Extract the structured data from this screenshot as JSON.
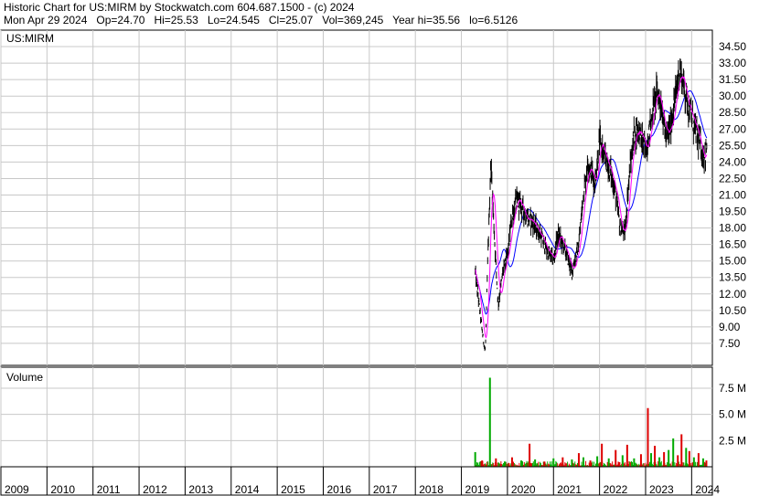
{
  "header": {
    "line1": "Historic Chart for US:MIRM by Stockwatch.com 604.687.1500 - (c) 2024",
    "line2": "Mon Apr 29 2024   Op=24.70   Hi=25.53   Lo=24.545   Cl=25.07   Vol=369,245   Year hi=35.56   lo=6.5126"
  },
  "chart_data": {
    "type": "line",
    "symbol_label": "US:MIRM",
    "volume_label": "Volume",
    "price_ylim": [
      5.5,
      36.0
    ],
    "price_ticks": [
      "7.50",
      "9.00",
      "10.50",
      "12.00",
      "13.50",
      "15.00",
      "16.50",
      "18.00",
      "19.50",
      "21.00",
      "22.50",
      "24.00",
      "25.50",
      "27.00",
      "28.50",
      "30.00",
      "31.50",
      "33.00",
      "34.50"
    ],
    "volume_ylim": [
      0,
      9.5
    ],
    "volume_ticks": [
      "2.5 M",
      "5.0 M",
      "7.5 M"
    ],
    "x_labels": [
      "2009",
      "2010",
      "2011",
      "2012",
      "2013",
      "2014",
      "2015",
      "2016",
      "2017",
      "2018",
      "2019",
      "2020",
      "2021",
      "2022",
      "2023",
      "2024"
    ],
    "grid": true,
    "colors": {
      "price": "#000000",
      "ma_short": "#ff00ff",
      "ma_long": "#0000ff",
      "vol_up": "#00aa00",
      "vol_down": "#dd0000",
      "grid": "#c8c8c8"
    },
    "series": [
      {
        "x": [
          2019.3,
          2019.4,
          2019.47,
          2019.52,
          2019.58,
          2019.64,
          2019.72,
          2019.8,
          2019.9,
          2020.0,
          2020.1,
          2020.2,
          2020.3,
          2020.4,
          2020.55,
          2020.7,
          2020.85,
          2021.0,
          2021.1,
          2021.25,
          2021.4,
          2021.55,
          2021.65,
          2021.75,
          2021.9,
          2022.0,
          2022.1,
          2022.25,
          2022.35,
          2022.45,
          2022.55,
          2022.65,
          2022.75,
          2022.85,
          2023.0,
          2023.15,
          2023.25,
          2023.35,
          2023.45,
          2023.55,
          2023.65,
          2023.75,
          2023.85,
          2024.0,
          2024.15,
          2024.25,
          2024.33
        ],
        "values": [
          14.0,
          10.5,
          8.0,
          6.8,
          16.0,
          24.0,
          17.0,
          11.0,
          14.0,
          15.5,
          19.0,
          20.5,
          20.0,
          19.0,
          18.5,
          17.5,
          16.0,
          15.0,
          17.5,
          16.0,
          14.0,
          16.5,
          21.0,
          24.0,
          22.0,
          26.0,
          24.5,
          23.0,
          21.0,
          18.0,
          17.5,
          23.0,
          26.5,
          27.0,
          25.0,
          28.5,
          30.5,
          29.0,
          26.0,
          27.5,
          30.0,
          32.5,
          30.5,
          28.0,
          26.0,
          24.5,
          25.07
        ]
      }
    ],
    "volume": {
      "x": [
        2019.3,
        2019.45,
        2019.62,
        2019.75,
        2019.95,
        2020.1,
        2020.3,
        2020.48,
        2020.6,
        2020.8,
        2021.0,
        2021.2,
        2021.4,
        2021.55,
        2021.65,
        2021.8,
        2021.95,
        2022.05,
        2022.2,
        2022.35,
        2022.5,
        2022.6,
        2022.75,
        2022.9,
        2023.05,
        2023.12,
        2023.2,
        2023.3,
        2023.4,
        2023.5,
        2023.6,
        2023.7,
        2023.78,
        2023.88,
        2023.95,
        2024.05,
        2024.15,
        2024.25,
        2024.32
      ],
      "values": [
        1.4,
        0.6,
        8.5,
        0.8,
        0.5,
        0.9,
        0.6,
        2.2,
        0.7,
        0.5,
        0.8,
        0.9,
        0.7,
        1.3,
        0.9,
        0.6,
        1.0,
        2.2,
        0.8,
        1.6,
        1.1,
        2.1,
        0.8,
        1.2,
        5.6,
        1.3,
        2.0,
        0.9,
        1.4,
        1.6,
        2.7,
        1.1,
        3.1,
        1.8,
        1.5,
        0.9,
        1.3,
        0.8,
        0.6
      ],
      "up": [
        true,
        false,
        true,
        false,
        true,
        false,
        true,
        false,
        true,
        false,
        true,
        false,
        true,
        false,
        true,
        false,
        true,
        false,
        true,
        false,
        true,
        false,
        true,
        false,
        false,
        true,
        false,
        true,
        false,
        true,
        true,
        false,
        false,
        true,
        false,
        true,
        false,
        true,
        false
      ]
    }
  }
}
